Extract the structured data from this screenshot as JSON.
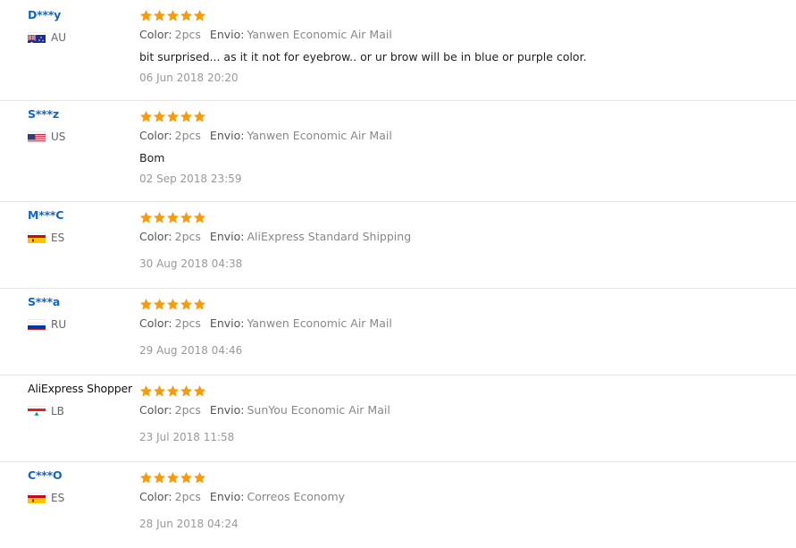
{
  "colors": {
    "username": "#1565c0",
    "star": "#f89b0b",
    "divider": "#e6e6e6"
  },
  "labels": {
    "color": "Color:",
    "shipping": "Envio:"
  },
  "reviews": [
    {
      "user": "D***y",
      "country": "AU",
      "flag": "flag-australia-icon",
      "rating": 5,
      "color": "2pcs",
      "shipping": "Yanwen Economic Air Mail",
      "feedback": "bit surprised... as it it not for eyebrow.. or ur brow will be in blue or purple color.",
      "date": "06 Jun 2018 20:20"
    },
    {
      "user": "S***z",
      "country": "US",
      "flag": "flag-usa-icon",
      "rating": 5,
      "color": "2pcs",
      "shipping": "Yanwen Economic Air Mail",
      "feedback": "Bom",
      "date": "02 Sep 2018 23:59"
    },
    {
      "user": "M***C",
      "country": "ES",
      "flag": "flag-spain-icon",
      "rating": 5,
      "color": "2pcs",
      "shipping": "AliExpress Standard Shipping",
      "feedback": "",
      "date": "30 Aug 2018 04:38"
    },
    {
      "user": "S***a",
      "country": "RU",
      "flag": "flag-russia-icon",
      "rating": 5,
      "color": "2pcs",
      "shipping": "Yanwen Economic Air Mail",
      "feedback": "",
      "date": "29 Aug 2018 04:46"
    },
    {
      "user": "AliExpress Shopper",
      "country": "LB",
      "flag": "flag-lebanon-icon",
      "rating": 5,
      "color": "2pcs",
      "shipping": "SunYou Economic Air Mail",
      "feedback": "",
      "date": "23 Jul 2018 11:58"
    },
    {
      "user": "C***O",
      "country": "ES",
      "flag": "flag-spain-icon",
      "rating": 5,
      "color": "2pcs",
      "shipping": "Correos Economy",
      "feedback": "",
      "date": "28 Jun 2018 04:24"
    }
  ]
}
